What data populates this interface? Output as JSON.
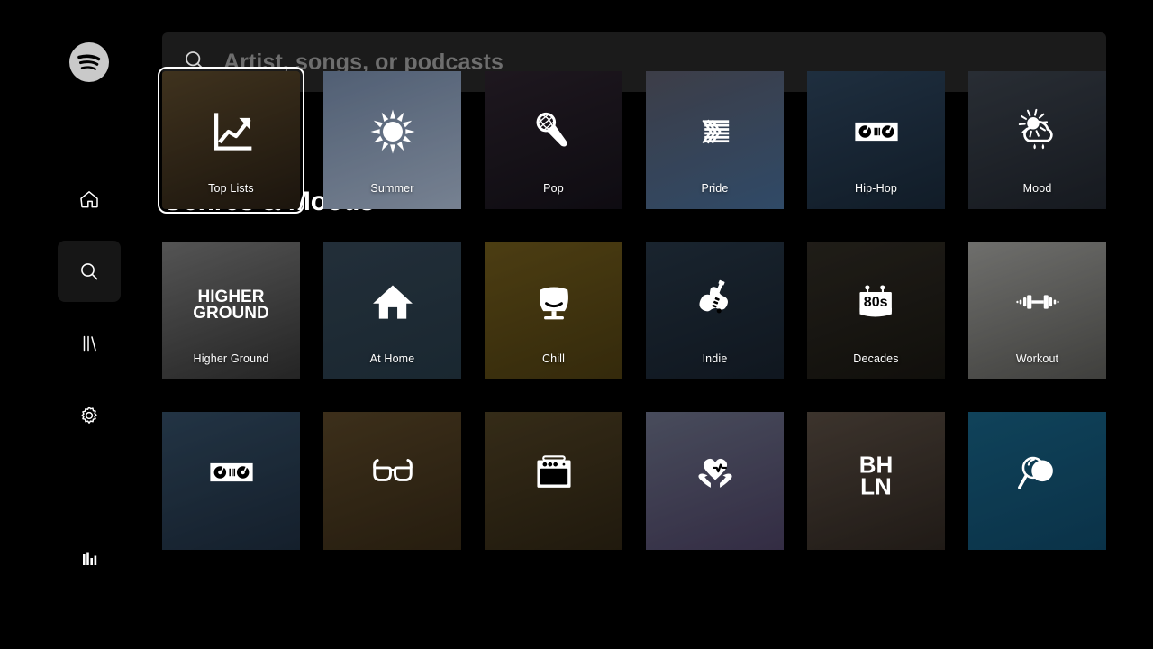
{
  "app": {
    "name": "Spotify",
    "brand_color": "#1db954",
    "background": "#000000",
    "logo_icon": "spotify-logo-icon"
  },
  "search": {
    "placeholder": "Artist, songs, or podcasts",
    "value": "",
    "icon": "search-icon"
  },
  "sidebar": {
    "items": [
      {
        "id": "home",
        "label": "Home",
        "icon": "home-icon",
        "active": false
      },
      {
        "id": "search",
        "label": "Search",
        "icon": "search-icon",
        "active": true
      },
      {
        "id": "library",
        "label": "Library",
        "icon": "library-icon",
        "active": false
      },
      {
        "id": "settings",
        "label": "Settings",
        "icon": "gear-icon",
        "active": false
      }
    ],
    "bottom_item": {
      "id": "now-playing",
      "label": "Now Playing",
      "icon": "equalizer-icon",
      "active": false
    }
  },
  "main": {
    "title": "Genres & Moods",
    "cards": [
      {
        "label": "Top Lists",
        "icon": "trending-chart-icon",
        "focused": true,
        "bg_top": "#5a4a2e",
        "bg_bottom": "#1a1510",
        "tint": "rgba(30,22,10,0.45)"
      },
      {
        "label": "Summer",
        "icon": "sun-icon",
        "focused": false,
        "bg_top": "#5e6e84",
        "bg_bottom": "#8c98a8",
        "tint": "rgba(20,30,45,0.18)"
      },
      {
        "label": "Pop",
        "icon": "microphone-icon",
        "focused": false,
        "bg_top": "#2a2028",
        "bg_bottom": "#120e14",
        "tint": "rgba(10,8,14,0.35)"
      },
      {
        "label": "Pride",
        "icon": "pride-flag-icon",
        "focused": false,
        "bg_top": "#4a4a52",
        "bg_bottom": "#3a5a7a",
        "tint": "rgba(15,20,35,0.22)"
      },
      {
        "label": "Hip-Hop",
        "icon": "turntables-icon",
        "focused": false,
        "bg_top": "#2b3f52",
        "bg_bottom": "#16222e",
        "tint": "rgba(8,18,30,0.35)"
      },
      {
        "label": "Mood",
        "icon": "sun-cloud-rain-icon",
        "focused": false,
        "bg_top": "#3a4048",
        "bg_bottom": "#1c2026",
        "tint": "rgba(12,16,22,0.38)"
      },
      {
        "label": "Higher Ground",
        "icon": "",
        "focused": false,
        "bg_top": "#6a6a6a",
        "bg_bottom": "#2a2a2a",
        "tint": "rgba(20,20,20,0.25)",
        "overlay_text": "HIGHER\nGROUND",
        "overlay_size": 19
      },
      {
        "label": "At Home",
        "icon": "house-icon",
        "focused": false,
        "bg_top": "#2c3a46",
        "bg_bottom": "#20303a",
        "tint": "rgba(10,18,26,0.28)"
      },
      {
        "label": "Chill",
        "icon": "armchair-icon",
        "focused": false,
        "bg_top": "#5c4a18",
        "bg_bottom": "#3a2e0e",
        "tint": "rgba(40,32,8,0.30)"
      },
      {
        "label": "Indie",
        "icon": "guitar-icon",
        "focused": false,
        "bg_top": "#23303c",
        "bg_bottom": "#141c24",
        "tint": "rgba(8,14,22,0.35)"
      },
      {
        "label": "Decades",
        "icon": "calendar-80s-icon",
        "focused": false,
        "bg_top": "#2a2620",
        "bg_bottom": "#14120e",
        "tint": "rgba(10,9,6,0.30)"
      },
      {
        "label": "Workout",
        "icon": "dumbbell-icon",
        "focused": false,
        "bg_top": "#8a8a88",
        "bg_bottom": "#4a4a48",
        "tint": "rgba(30,30,28,0.25)"
      },
      {
        "label": "",
        "icon": "turntables-icon",
        "focused": false,
        "bg_top": "#2f4456",
        "bg_bottom": "#1a2632",
        "tint": "rgba(8,18,30,0.32)"
      },
      {
        "label": "",
        "icon": "sunglasses-icon",
        "focused": false,
        "bg_top": "#4a3a22",
        "bg_bottom": "#2a2012",
        "tint": "rgba(30,22,10,0.30)"
      },
      {
        "label": "",
        "icon": "amplifier-icon",
        "focused": false,
        "bg_top": "#43381f",
        "bg_bottom": "#241d10",
        "tint": "rgba(26,20,8,0.32)"
      },
      {
        "label": "",
        "icon": "heart-hands-icon",
        "focused": false,
        "bg_top": "#5a5f70",
        "bg_bottom": "#3e3550",
        "tint": "rgba(20,18,32,0.25)"
      },
      {
        "label": "",
        "icon": "",
        "focused": false,
        "bg_top": "#4a4038",
        "bg_bottom": "#241e1a",
        "tint": "rgba(18,14,12,0.25)",
        "overlay_text": "BH\nLN",
        "overlay_size": 26
      },
      {
        "label": "",
        "icon": "magnifier-icon",
        "focused": false,
        "bg_top": "#14506a",
        "bg_bottom": "#0d3a52",
        "tint": "rgba(5,28,42,0.25)"
      }
    ]
  }
}
